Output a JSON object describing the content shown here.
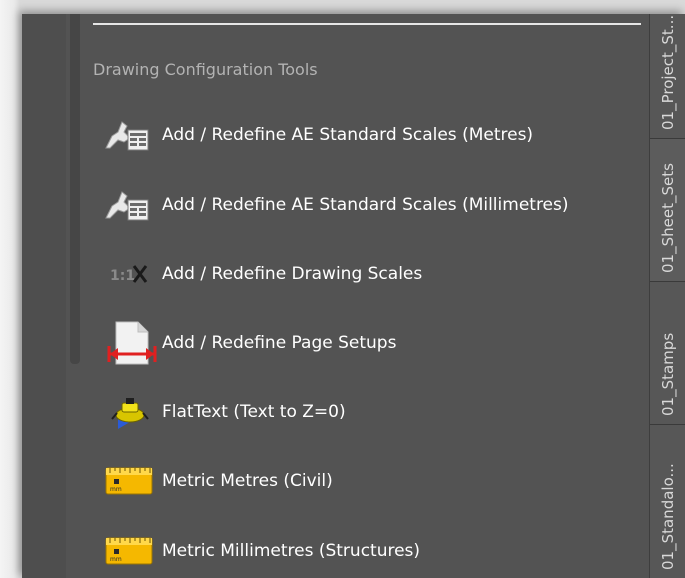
{
  "section_title": "Drawing Configuration Tools",
  "tools": [
    {
      "label": "Add / Redefine AE Standard Scales (Metres)",
      "icon": "scale-table-icon"
    },
    {
      "label": "Add / Redefine AE Standard Scales (Millimetres)",
      "icon": "scale-table-icon"
    },
    {
      "label": "Add / Redefine Drawing Scales",
      "icon": "scale-ratio-icon"
    },
    {
      "label": "Add / Redefine Page Setups",
      "icon": "page-setup-icon"
    },
    {
      "label": "FlatText (Text to Z=0)",
      "icon": "flattext-icon"
    },
    {
      "label": "Metric Metres (Civil)",
      "icon": "ruler-mm-icon"
    },
    {
      "label": "Metric Millimetres (Structures)",
      "icon": "ruler-mm-icon"
    }
  ],
  "icon_text": {
    "scale_ratio": "1:1",
    "ruler_unit": "mm"
  },
  "side_tabs": [
    "01_Project_St...",
    "01_Sheet_Sets",
    "01_Stamps",
    "01_Standalo..."
  ],
  "colors": {
    "panel": "#535353",
    "text": "#ffffff",
    "muted": "#b3b3b3",
    "tab_text": "#d8d8d8",
    "ruler": "#f5b800",
    "arrow": "#e02020"
  }
}
